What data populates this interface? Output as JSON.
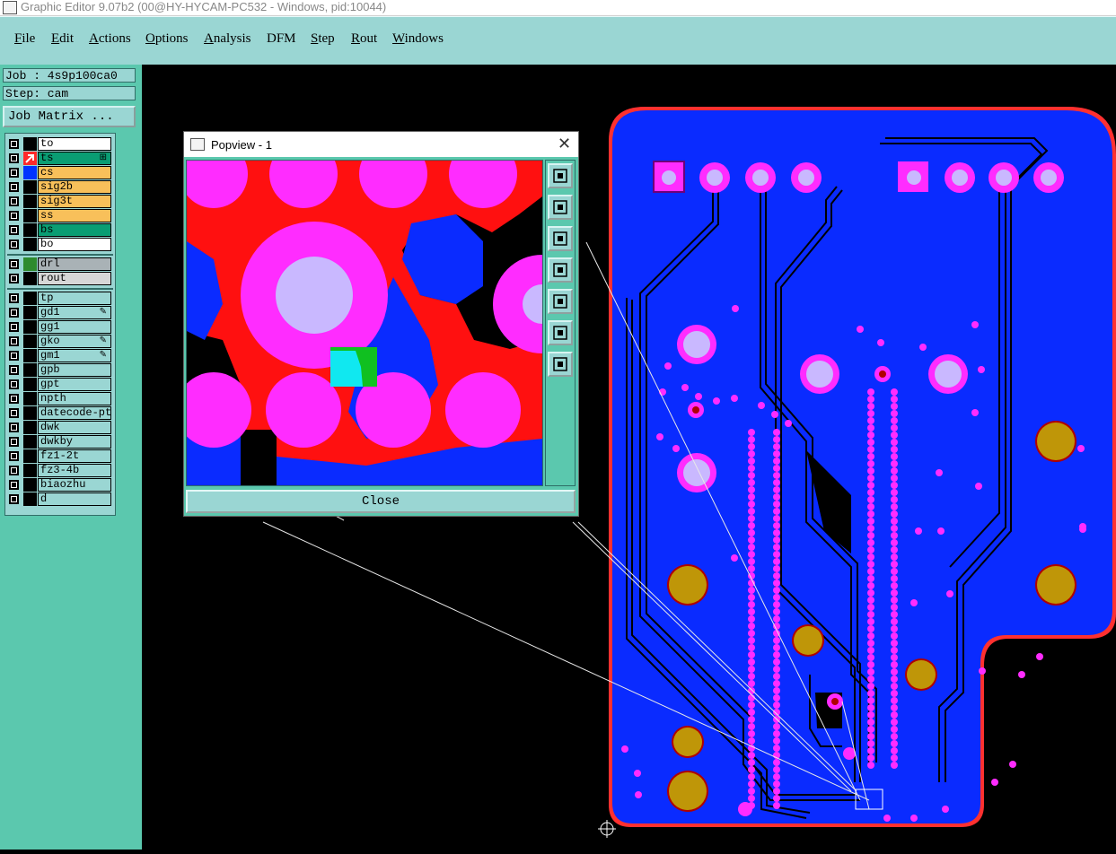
{
  "window": {
    "title": "Graphic Editor 9.07b2 (00@HY-HYCAM-PC532 - Windows, pid:10044)"
  },
  "menu": [
    {
      "label": "File",
      "underline": "F",
      "rest": "ile"
    },
    {
      "label": "Edit",
      "underline": "E",
      "rest": "dit"
    },
    {
      "label": "Actions",
      "underline": "A",
      "rest": "ctions"
    },
    {
      "label": "Options",
      "underline": "O",
      "rest": "ptions"
    },
    {
      "label": "Analysis",
      "underline": "A",
      "rest": "nalysis"
    },
    {
      "label": "DFM",
      "underline": "",
      "rest": "DFM"
    },
    {
      "label": "Step",
      "underline": "S",
      "rest": "tep"
    },
    {
      "label": "Rout",
      "underline": "R",
      "rest": "out"
    },
    {
      "label": "Windows",
      "underline": "W",
      "rest": "indows"
    }
  ],
  "job": {
    "label": "Job : 4s9p100ca0",
    "step": "Step: cam",
    "matrix_button": "Job Matrix ..."
  },
  "layers": [
    {
      "name": "to",
      "color": "#ffffff",
      "swatch": "#000000"
    },
    {
      "name": "ts",
      "color": "#0a9d73",
      "swatch": "#ff2a2a",
      "active": true,
      "flag": "⊞"
    },
    {
      "name": "cs",
      "color": "#f8c05a",
      "swatch": "#0033ff"
    },
    {
      "name": "sig2b",
      "color": "#f8c05a",
      "swatch": "#000000"
    },
    {
      "name": "sig3t",
      "color": "#f8c05a",
      "swatch": "#000000"
    },
    {
      "name": "ss",
      "color": "#f8c05a",
      "swatch": "#000000"
    },
    {
      "name": "bs",
      "color": "#0a9d73",
      "swatch": "#000000"
    },
    {
      "name": "bo",
      "color": "#ffffff",
      "swatch": "#000000"
    },
    {
      "name": "drl",
      "color": "#a9b2b6",
      "swatch": "#2e8b2e"
    },
    {
      "name": "rout",
      "color": "#d7d7d7",
      "swatch": "#000000"
    },
    {
      "name": "tp",
      "color": "#9ad6d3",
      "swatch": "#000000"
    },
    {
      "name": "gd1",
      "color": "#9ad6d3",
      "swatch": "#000000",
      "flag": "✎"
    },
    {
      "name": "gg1",
      "color": "#9ad6d3",
      "swatch": "#000000"
    },
    {
      "name": "gko",
      "color": "#9ad6d3",
      "swatch": "#000000",
      "flag": "✎"
    },
    {
      "name": "gm1",
      "color": "#9ad6d3",
      "swatch": "#000000",
      "flag": "✎"
    },
    {
      "name": "gpb",
      "color": "#9ad6d3",
      "swatch": "#000000"
    },
    {
      "name": "gpt",
      "color": "#9ad6d3",
      "swatch": "#000000"
    },
    {
      "name": "npth",
      "color": "#9ad6d3",
      "swatch": "#000000"
    },
    {
      "name": "datecode-ptc",
      "color": "#9ad6d3",
      "swatch": "#000000"
    },
    {
      "name": "dwk",
      "color": "#9ad6d3",
      "swatch": "#000000"
    },
    {
      "name": "dwkby",
      "color": "#9ad6d3",
      "swatch": "#000000"
    },
    {
      "name": "fz1-2t",
      "color": "#9ad6d3",
      "swatch": "#000000"
    },
    {
      "name": "fz3-4b",
      "color": "#9ad6d3",
      "swatch": "#000000"
    },
    {
      "name": "biaozhu",
      "color": "#9ad6d3",
      "swatch": "#000000"
    },
    {
      "name": "d",
      "color": "#9ad6d3",
      "swatch": "#000000"
    }
  ],
  "popview": {
    "title": "Popview - 1",
    "close_label": "Close",
    "tools": [
      "zoom-fit-icon",
      "move-up-icon",
      "move-down-icon",
      "move-left-icon",
      "move-right-icon",
      "zoom-in-icon",
      "zoom-out-icon"
    ]
  },
  "colors": {
    "board": "#0a2bff",
    "pad": "#ff2cff",
    "drill": "#c9b8ff",
    "gold": "#bf9608",
    "outline": "#ff3030"
  }
}
